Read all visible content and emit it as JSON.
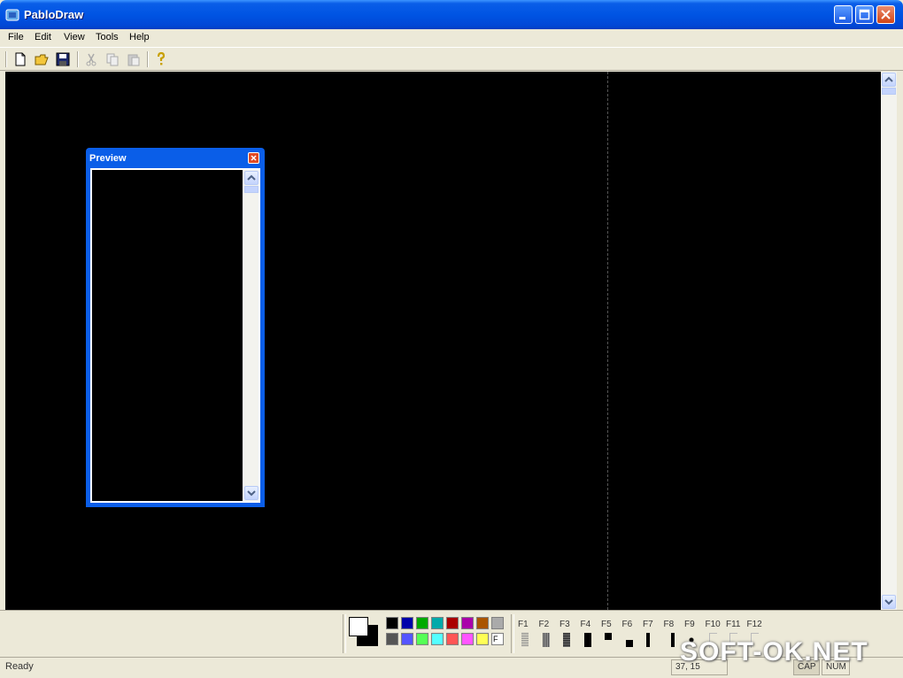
{
  "window": {
    "title": "PabloDraw"
  },
  "menu": {
    "items": [
      "File",
      "Edit",
      "View",
      "Tools",
      "Help"
    ]
  },
  "toolbar": {
    "buttons": [
      "new-file-icon",
      "open-folder-icon",
      "save-disk-icon",
      "cut-icon",
      "copy-icon",
      "paste-icon",
      "help-icon"
    ]
  },
  "preview": {
    "title": "Preview"
  },
  "palette": {
    "foreground": "#ffffff",
    "background": "#000000",
    "colors_top": [
      "#000000",
      "#0000aa",
      "#00aa00",
      "#00aaaa",
      "#aa0000",
      "#aa00aa",
      "#aa5500",
      "#aaaaaa"
    ],
    "colors_bottom": [
      "#555555",
      "#5555ff",
      "#55ff55",
      "#55ffff",
      "#ff5555",
      "#ff55ff",
      "#ffff55",
      "#ffffff"
    ],
    "fkeys": [
      "F1",
      "F2",
      "F3",
      "F4",
      "F5",
      "F6",
      "F7",
      "F8",
      "F9",
      "F10",
      "F11",
      "F12"
    ],
    "selected_marker": "F"
  },
  "status": {
    "text": "Ready",
    "position": "37, 15",
    "caps": "CAP",
    "num": "NUM"
  },
  "watermark": "SOFT-OK.NET"
}
